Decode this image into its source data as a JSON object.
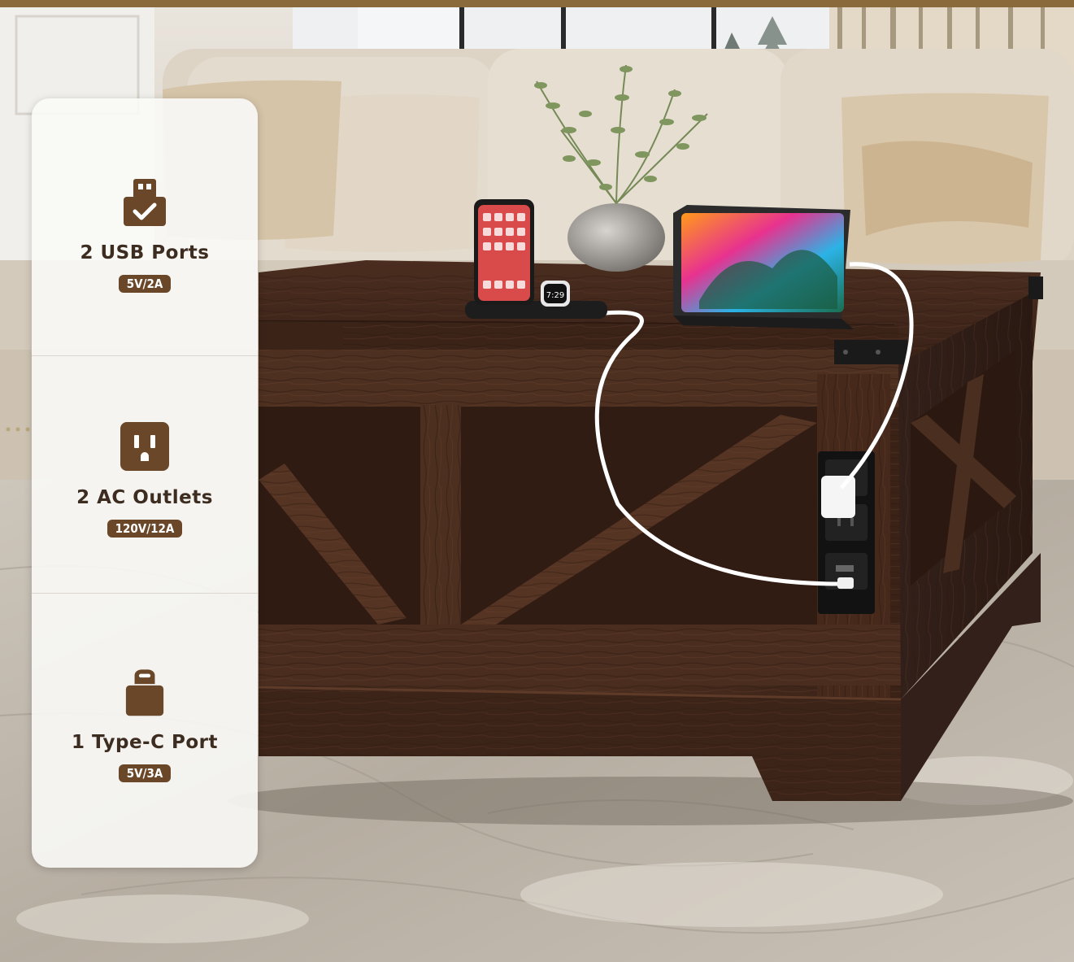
{
  "features": [
    {
      "icon": "usb-icon",
      "title": "2 USB Ports",
      "spec": "5V/2A"
    },
    {
      "icon": "ac-outlet-icon",
      "title": "2 AC Outlets",
      "spec": "120V/12A"
    },
    {
      "icon": "type-c-icon",
      "title": "1 Type-C Port",
      "spec": "5V/3A"
    }
  ],
  "phone_clock": "7:29",
  "colors": {
    "accent_brown": "#6a4728",
    "wood_dark": "#3d2419",
    "sofa_beige": "#dcd3c5",
    "rug_gray": "#b9b1a6"
  }
}
